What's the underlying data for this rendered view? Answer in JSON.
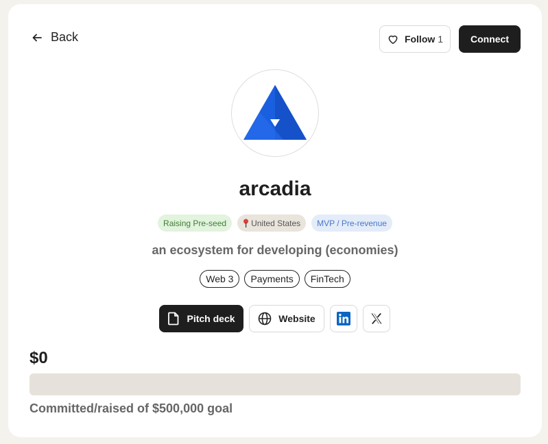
{
  "header": {
    "back_label": "Back",
    "follow_label": "Follow",
    "follow_count": "1",
    "connect_label": "Connect"
  },
  "company": {
    "name": "arcadia",
    "tagline": "an ecosystem for developing (economies)",
    "logo_icon": "arcadia-triangle-logo",
    "brand_color": "#1a5fe0"
  },
  "badges": {
    "raising": "Raising Pre-seed",
    "location": "United States",
    "stage": "MVP / Pre-revenue"
  },
  "tags": [
    "Web 3",
    "Payments",
    "FinTech"
  ],
  "links": {
    "pitch_deck_label": "Pitch deck",
    "website_label": "Website",
    "linkedin_icon": "linkedin-icon",
    "x_icon": "x-icon"
  },
  "fundraising": {
    "amount": "$0",
    "progress_fraction": 0,
    "goal_text": "Committed/raised of $500,000 goal"
  }
}
